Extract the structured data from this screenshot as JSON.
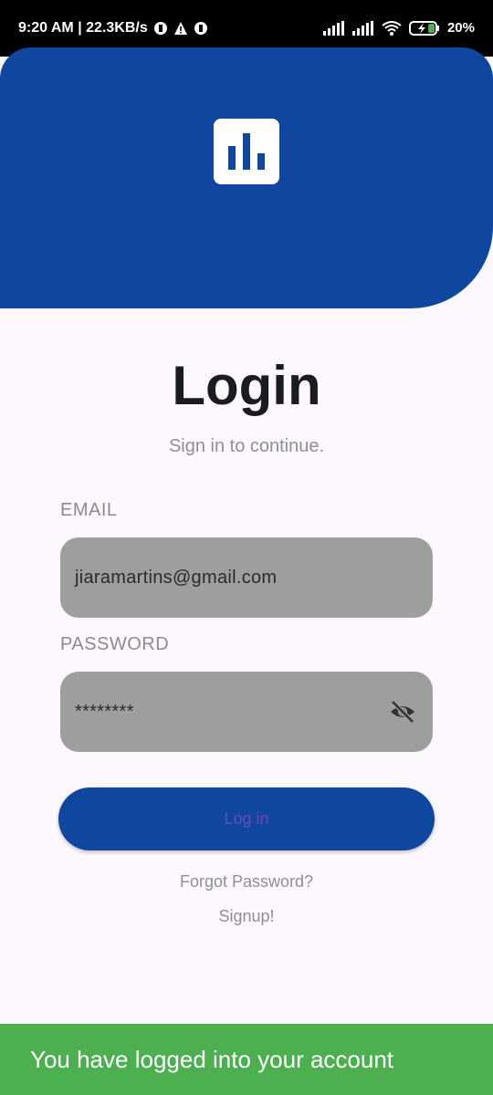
{
  "status_bar": {
    "time_speed": "9:20 AM | 22.3KB/s",
    "battery": "20%",
    "icons": [
      "data-icon",
      "warning-icon",
      "data-icon",
      "signal-icon",
      "signal-icon",
      "wifi-icon",
      "battery-charging-icon"
    ]
  },
  "header": {
    "logo_icon": "bar-chart-icon",
    "color": "#0f46a0"
  },
  "login": {
    "title": "Login",
    "subtitle": "Sign in to continue."
  },
  "form": {
    "email_label": "EMAIL",
    "email_value": "jiaramartins@gmail.com",
    "password_label": "PASSWORD",
    "password_value": "********",
    "password_toggle_icon": "eye-off-icon"
  },
  "actions": {
    "login_label": "Log in",
    "forgot_label": "Forgot Password?",
    "signup_label": "Signup!"
  },
  "snackbar": {
    "message": "You have logged into your account",
    "color": "#4caf50"
  }
}
